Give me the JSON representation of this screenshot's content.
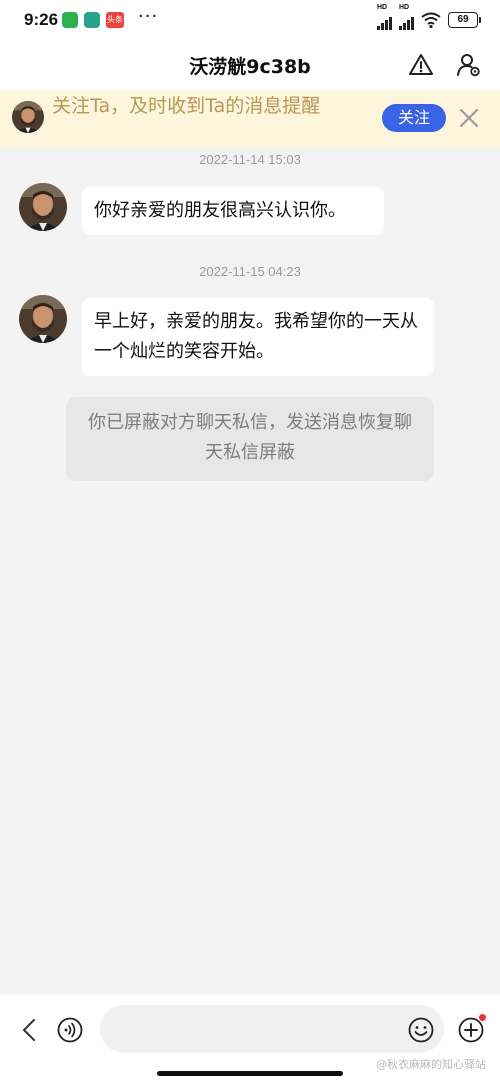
{
  "status_bar": {
    "time": "9:26",
    "app_badge_text": "头条",
    "more_dots": "···",
    "hd_label": "HD",
    "battery": "69"
  },
  "header": {
    "title": "沃涝觥9c38b",
    "warning_icon": "warning-triangle-icon",
    "profile_icon": "user-settings-icon"
  },
  "follow_banner": {
    "text": "关注Ta，及时收到Ta的消息提醒",
    "follow_label": "关注",
    "close_icon": "close-icon",
    "background": "#fdf5dc",
    "text_color": "#b79857"
  },
  "messages": [
    {
      "timestamp": "2022-11-14 15:03",
      "text": "你好亲爱的朋友很高兴认识你。"
    },
    {
      "timestamp": "2022-11-15 04:23",
      "text": "早上好，亲爱的朋友。我希望你的一天从一个灿烂的笑容开始。"
    }
  ],
  "block_notice": "你已屏蔽对方聊天私信，发送消息恢复聊天私信屏蔽",
  "input_bar": {
    "placeholder": "",
    "back_icon": "chevron-left-icon",
    "voice_icon": "voice-icon",
    "emoji_icon": "emoji-icon",
    "add_icon": "plus-circle-icon"
  },
  "watermark": "@秋衣麻麻的知心驿站",
  "colors": {
    "accent": "#3a63e6",
    "page_background": "#f3f3f3",
    "notification_dot": "#f2323b"
  }
}
